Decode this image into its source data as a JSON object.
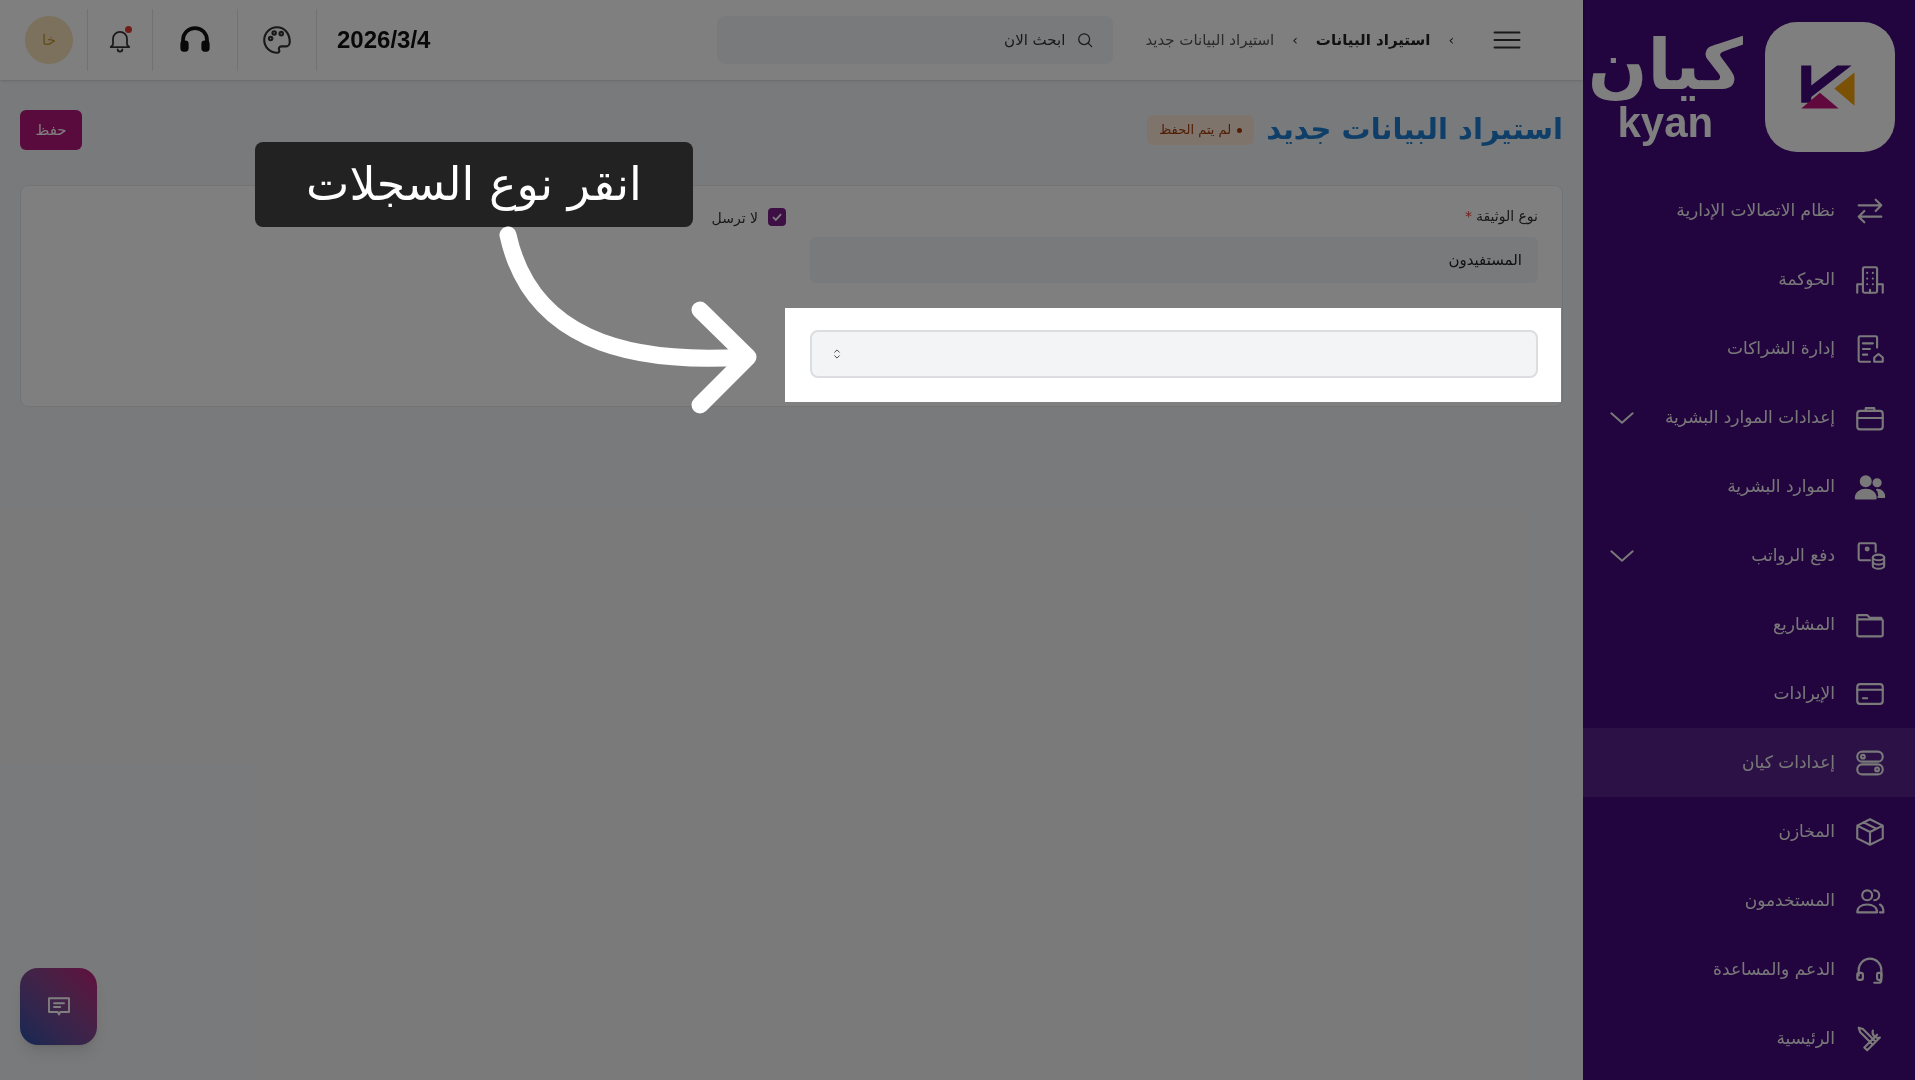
{
  "sidebar": {
    "logo": {
      "arabic": "كيان",
      "latin": "kyan"
    },
    "items": [
      {
        "label": "نظام الاتصالات الإدارية",
        "selected": false,
        "has_submenu": false
      },
      {
        "label": "الحوكمة",
        "selected": false,
        "has_submenu": false
      },
      {
        "label": "إدارة الشراكات",
        "selected": false,
        "has_submenu": false
      },
      {
        "label": "إعدادات الموارد البشرية",
        "selected": false,
        "has_submenu": true
      },
      {
        "label": "الموارد البشرية",
        "selected": false,
        "has_submenu": false
      },
      {
        "label": "دفع الرواتب",
        "selected": false,
        "has_submenu": true
      },
      {
        "label": "المشاريع",
        "selected": false,
        "has_submenu": false
      },
      {
        "label": "الإيرادات",
        "selected": false,
        "has_submenu": false
      },
      {
        "label": "إعدادات كيان",
        "selected": true,
        "has_submenu": false
      },
      {
        "label": "المخازن",
        "selected": false,
        "has_submenu": false
      },
      {
        "label": "المستخدمون",
        "selected": false,
        "has_submenu": false
      },
      {
        "label": "الدعم والمساعدة",
        "selected": false,
        "has_submenu": false
      },
      {
        "label": "الرئيسية",
        "selected": false,
        "has_submenu": false
      }
    ]
  },
  "topbar": {
    "breadcrumbs": [
      {
        "separator": "›",
        "label": "استيراد البيانات"
      },
      {
        "separator": "›",
        "label": "استيراد البيانات جديد"
      }
    ],
    "search": {
      "placeholder": "ابحث الان"
    },
    "date": "2026/3/4",
    "has_notification": true,
    "avatar": "خا"
  },
  "page": {
    "title": "استيراد البيانات جديد",
    "status": "لم يتم الحفظ",
    "save_button": "حفظ",
    "form": {
      "document_type": {
        "label": "نوع الوثيقة",
        "required": true,
        "required_mark": "*",
        "value": "المستفيدون"
      },
      "checkbox": {
        "label": "لا ترسل",
        "checked": true
      }
    }
  },
  "tour": {
    "text": "انقر نوع السجلات"
  }
}
